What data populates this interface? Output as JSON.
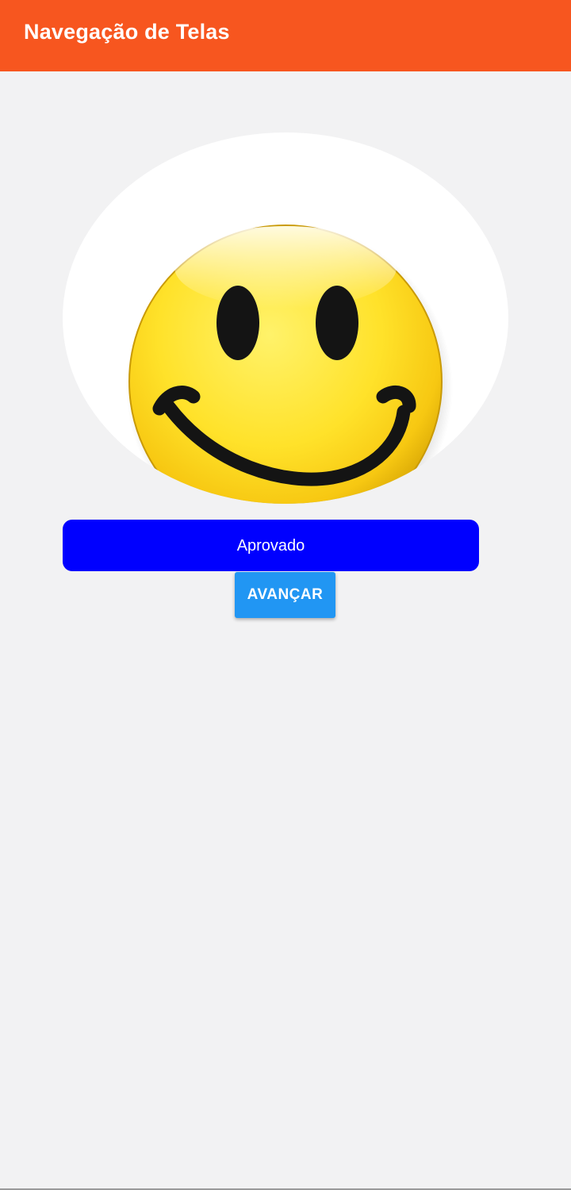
{
  "app_bar": {
    "title": "Navegação de Telas",
    "color": "#f7561f"
  },
  "image": {
    "icon": "smiley-face-icon",
    "face_color": "#ffe22a",
    "feature_color": "#141414",
    "frame_color": "#ffffff"
  },
  "status": {
    "label": "Aprovado",
    "background": "#0000ff"
  },
  "next_button": {
    "label": "AVANÇAR",
    "background": "#2196f3"
  },
  "background_color": "#f2f2f3"
}
